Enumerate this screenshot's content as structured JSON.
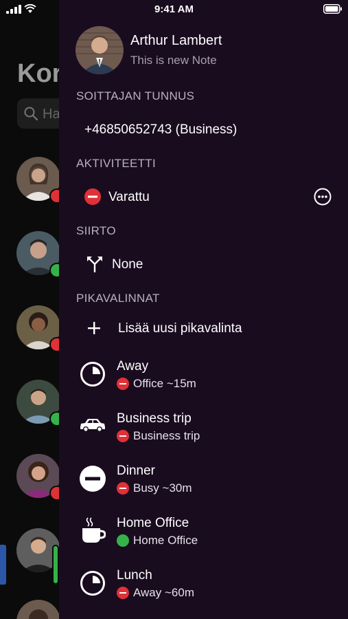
{
  "status_bar": {
    "time": "9:41 AM"
  },
  "background": {
    "title": "Kor",
    "search_placeholder": "Ha"
  },
  "profile": {
    "name": "Arthur Lambert",
    "note": "This is new Note"
  },
  "caller_id": {
    "section_title": "SOITTAJAN TUNNUS",
    "value": "+46850652743 (Business)"
  },
  "activity": {
    "section_title": "AKTIVITEETTI",
    "value": "Varattu"
  },
  "transfer": {
    "section_title": "SIIRTO",
    "value": "None"
  },
  "quick_dials": {
    "section_title": "PIKAVALINNAT",
    "add_label": "Lisää uusi pikavalinta",
    "items": [
      {
        "title": "Away",
        "status": "Office ~15m",
        "status_color": "red",
        "icon": "clock-icon"
      },
      {
        "title": "Business trip",
        "status": "Business trip",
        "status_color": "red",
        "icon": "car-icon"
      },
      {
        "title": "Dinner",
        "status": "Busy ~30m",
        "status_color": "red",
        "icon": "minus-circle-icon"
      },
      {
        "title": "Home Office",
        "status": "Home Office",
        "status_color": "green",
        "icon": "coffee-icon"
      },
      {
        "title": "Lunch",
        "status": "Away ~60m",
        "status_color": "red",
        "icon": "clock-icon"
      }
    ]
  },
  "colors": {
    "drawer_bg": "#1a0c1f",
    "busy_red": "#e03137",
    "available_green": "#36b24a",
    "section_text": "#b7b0bf"
  }
}
